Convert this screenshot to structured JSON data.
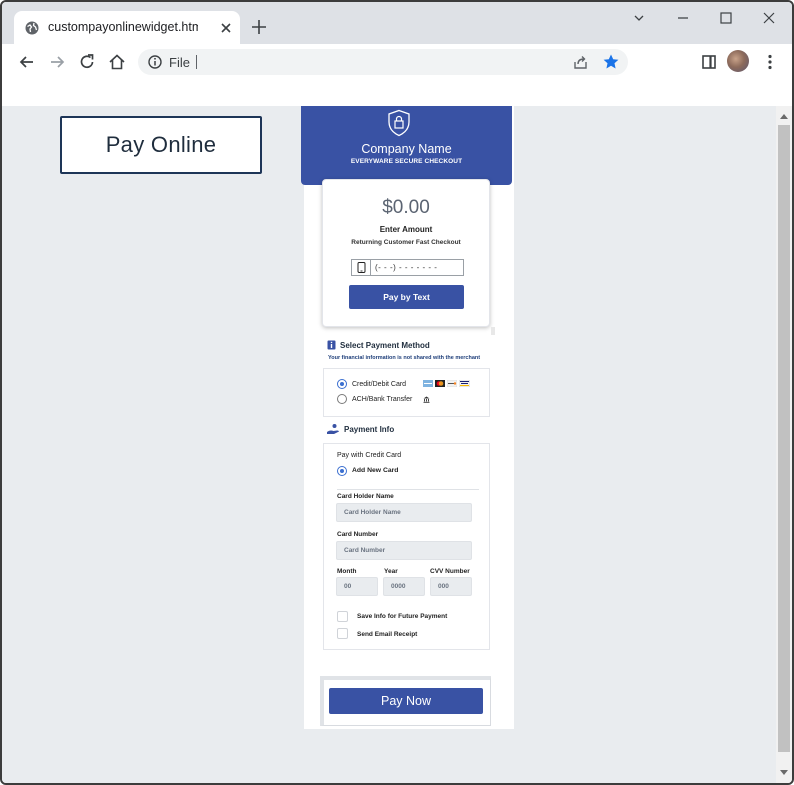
{
  "browser": {
    "tab_title": "custompayonlinewidget.html",
    "address_scheme": "File"
  },
  "page": {
    "pay_online_label": "Pay Online"
  },
  "widget": {
    "company_name": "Company Name",
    "secure_label": "EVERYWARE SECURE CHECKOUT",
    "amount": "$0.00",
    "enter_amount_label": "Enter Amount",
    "returning_label": "Returning Customer Fast Checkout",
    "phone_placeholder": "(- - -) - - - - - - -",
    "pay_by_text_label": "Pay by Text",
    "payment_method": {
      "heading": "Select Payment Method",
      "subheading": "Your financial information is not shared with the merchant",
      "options": [
        {
          "label": "Credit/Debit Card",
          "selected": true
        },
        {
          "label": "ACH/Bank Transfer",
          "selected": false
        }
      ]
    },
    "payment_info": {
      "heading": "Payment Info",
      "pay_with_label": "Pay with Credit Card",
      "add_new_card_label": "Add New Card",
      "card_holder_label": "Card Holder Name",
      "card_holder_placeholder": "Card Holder Name",
      "card_number_label": "Card Number",
      "card_number_placeholder": "Card Number",
      "month_label": "Month",
      "month_placeholder": "00",
      "year_label": "Year",
      "year_placeholder": "0000",
      "cvv_label": "CVV Number",
      "cvv_placeholder": "000",
      "save_info_label": "Save Info for Future Payment",
      "send_receipt_label": "Send Email Receipt"
    },
    "pay_now_label": "Pay Now"
  },
  "colors": {
    "brand": "#3952a4",
    "page_background": "#e9ecef",
    "star": "#1a73e8"
  }
}
